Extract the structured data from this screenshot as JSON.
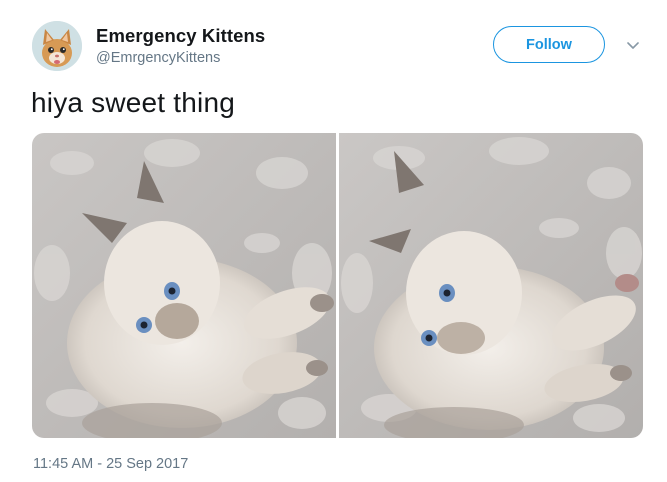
{
  "account": {
    "display_name": "Emergency Kittens",
    "handle": "@EmrgencyKittens"
  },
  "actions": {
    "follow_label": "Follow",
    "menu_icon": "chevron-down-icon"
  },
  "tweet": {
    "text": "hiya sweet thing",
    "timestamp": "11:45 AM - 25 Sep 2017"
  },
  "media": {
    "photos": [
      {
        "subject": "kitten-photo"
      },
      {
        "subject": "kitten-photo"
      }
    ]
  },
  "colors": {
    "accent": "#1b95e0",
    "text": "#14171a",
    "muted": "#657786"
  }
}
